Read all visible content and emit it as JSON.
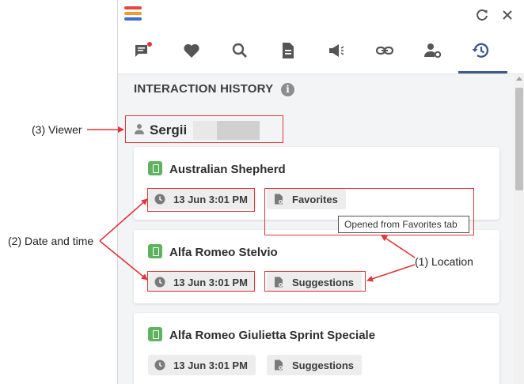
{
  "app": {
    "logo_colors": [
      "#e8453c",
      "#f39c2b",
      "#3b6fd6"
    ]
  },
  "tabs": [
    {
      "name": "comments-tab",
      "icon": "comment-icon"
    },
    {
      "name": "favorites-tab",
      "icon": "heart-icon"
    },
    {
      "name": "search-tab",
      "icon": "search-icon"
    },
    {
      "name": "documents-tab",
      "icon": "document-icon"
    },
    {
      "name": "announcements-tab",
      "icon": "megaphone-icon"
    },
    {
      "name": "links-tab",
      "icon": "link-icon"
    },
    {
      "name": "user-settings-tab",
      "icon": "user-gear-icon"
    },
    {
      "name": "history-tab",
      "icon": "history-icon",
      "active": true
    }
  ],
  "history": {
    "title": "INTERACTION HISTORY",
    "info_icon": "i",
    "viewer_name": "Sergii",
    "items": [
      {
        "title": "Australian Shepherd",
        "datetime": "13 Jun 3:01 PM",
        "location": "Favorites"
      },
      {
        "title": "Alfa Romeo Stelvio",
        "datetime": "13 Jun 3:01 PM",
        "location": "Suggestions"
      },
      {
        "title": "Alfa Romeo Giulietta Sprint Speciale",
        "datetime": "13 Jun 3:01 PM",
        "location": "Suggestions"
      }
    ],
    "tooltip": "Opened from Favorites tab"
  },
  "annotations": {
    "viewer": "(3) Viewer",
    "datetime": "(2) Date and time",
    "location": "(1) Location",
    "color": "#e0363a"
  }
}
